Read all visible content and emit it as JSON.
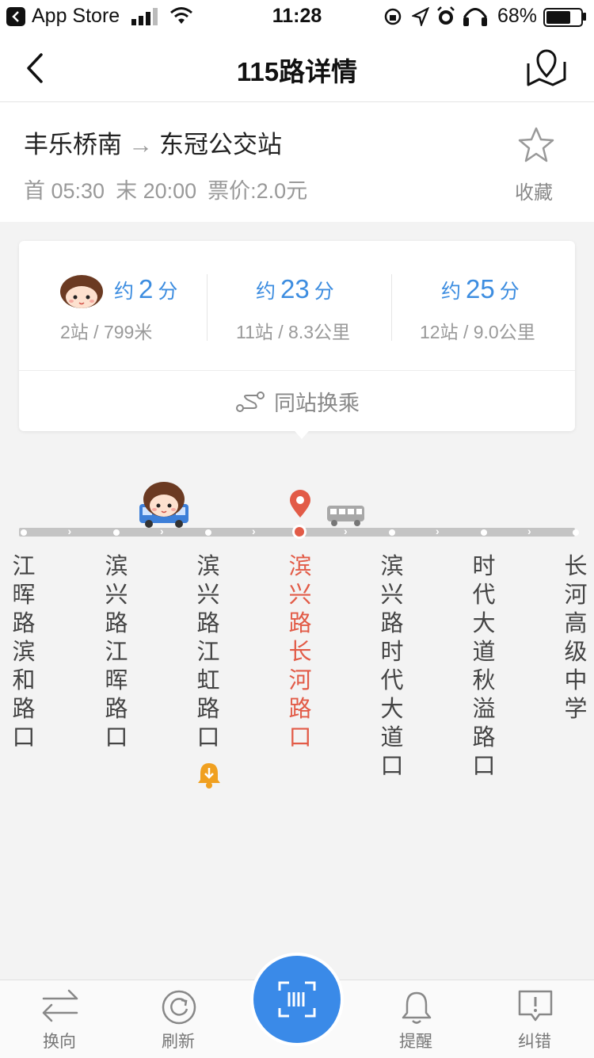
{
  "status_bar": {
    "back_app": "App Store",
    "time": "11:28",
    "battery": "68%",
    "battery_level": 0.68,
    "icons": [
      "signal-icon",
      "wifi-icon",
      "rotation-lock-icon",
      "location-icon",
      "alarm-icon",
      "headphones-icon",
      "battery-icon"
    ]
  },
  "nav": {
    "title": "115路详情",
    "back_icon": "back-chevron-icon",
    "map_icon": "map-pin-icon"
  },
  "route": {
    "from": "丰乐桥南",
    "arrow": "→",
    "to": "东冠公交站",
    "first": "首 05:30",
    "last": "末 20:00",
    "fare": "票价:2.0元",
    "favorite_label": "收藏",
    "favorite_icon": "star-icon"
  },
  "eta": [
    {
      "prefix": "约",
      "minutes": "2",
      "unit": "分",
      "detail": "2站 / 799米",
      "has_avatar": true
    },
    {
      "prefix": "约",
      "minutes": "23",
      "unit": "分",
      "detail": "11站 / 8.3公里"
    },
    {
      "prefix": "约",
      "minutes": "25",
      "unit": "分",
      "detail": "12站 / 9.0公里"
    }
  ],
  "transfer_label": "同站换乘",
  "stops": [
    {
      "name": "江晖路滨和路口",
      "current": false
    },
    {
      "name": "滨兴路江晖路口",
      "current": false
    },
    {
      "name": "滨兴路江虹路口",
      "current": false,
      "reminder": true
    },
    {
      "name": "滨兴路长河路口",
      "current": true
    },
    {
      "name": "滨兴路时代大道口",
      "current": false
    },
    {
      "name": "时代大道秋溢路口",
      "current": false
    },
    {
      "name": "长河高级中学",
      "current": false
    }
  ],
  "tabs": [
    {
      "label": "换向",
      "icon": "swap-icon"
    },
    {
      "label": "刷新",
      "icon": "refresh-icon"
    },
    {
      "label": "",
      "icon": "scan-icon"
    },
    {
      "label": "提醒",
      "icon": "bell-icon"
    },
    {
      "label": "纠错",
      "icon": "report-icon"
    }
  ],
  "colors": {
    "accent": "#3a8ae8",
    "current_stop": "#e25b47",
    "reminder": "#f0a020"
  }
}
